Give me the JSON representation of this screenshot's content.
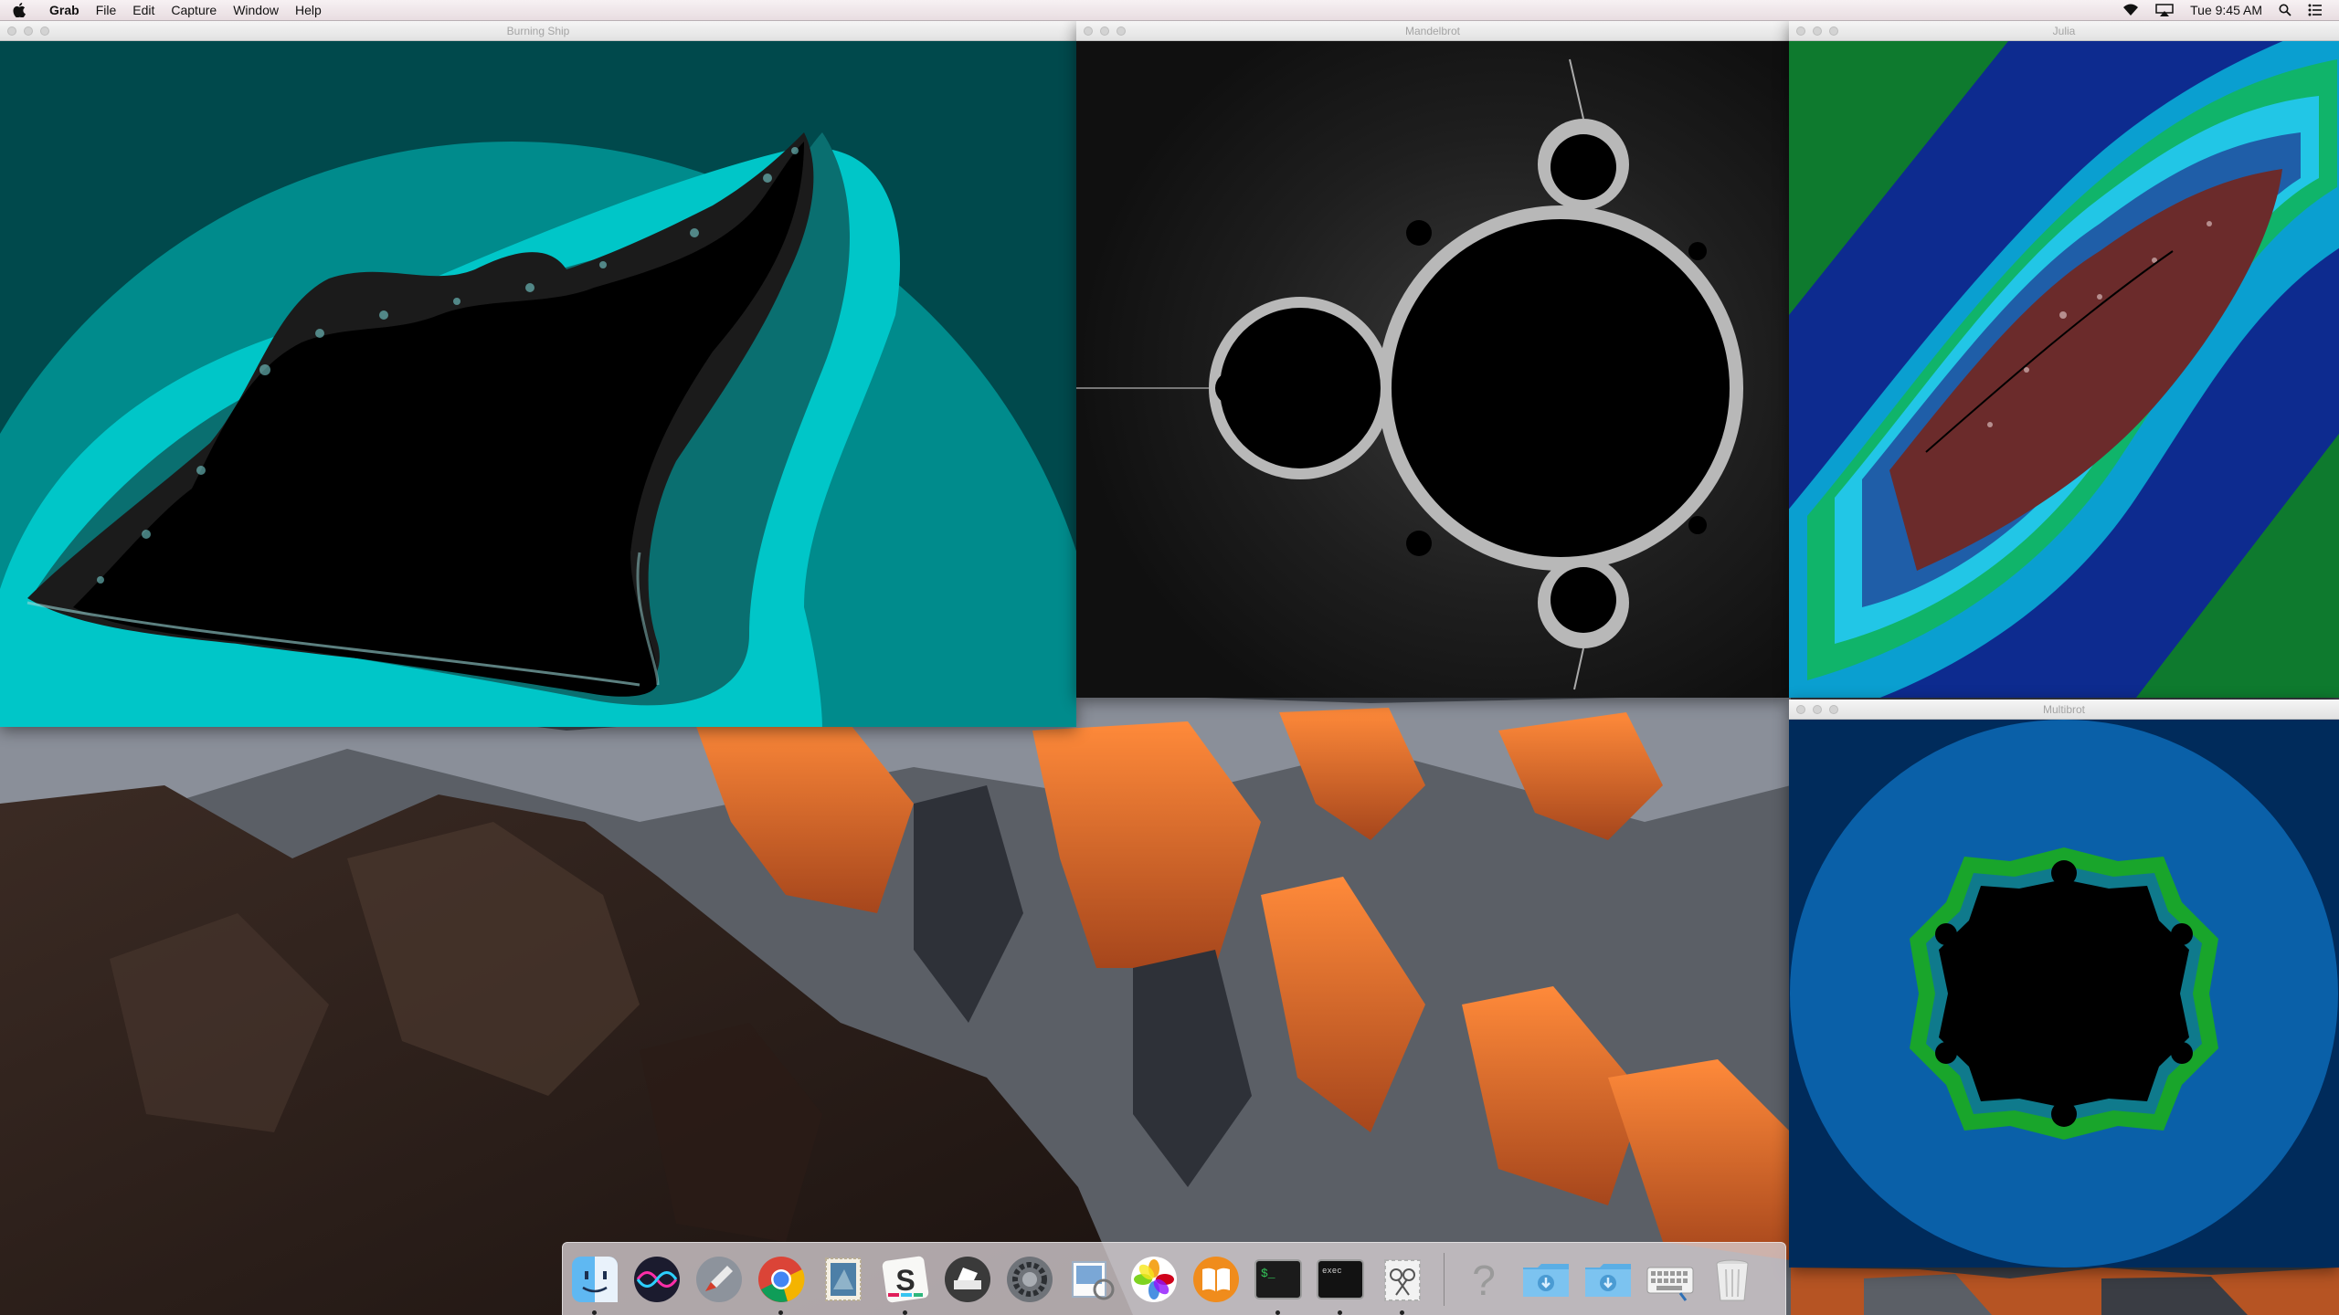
{
  "menubar": {
    "app_name": "Grab",
    "menus": [
      "File",
      "Edit",
      "Capture",
      "Window",
      "Help"
    ],
    "clock": "Tue 9:45 AM",
    "status_icons": [
      "wifi-icon",
      "airplay-icon",
      "spotlight-icon",
      "notification-center-icon"
    ]
  },
  "windows": {
    "burning_ship": {
      "title": "Burning Ship"
    },
    "mandelbrot": {
      "title": "Mandelbrot"
    },
    "julia": {
      "title": "Julia"
    },
    "multibrot": {
      "title": "Multibrot"
    }
  },
  "dock": {
    "apps": [
      {
        "name": "finder-icon",
        "running": true
      },
      {
        "name": "siri-icon",
        "running": false
      },
      {
        "name": "launchpad-icon",
        "running": false
      },
      {
        "name": "chrome-icon",
        "running": true
      },
      {
        "name": "mail-stamp-icon",
        "running": false
      },
      {
        "name": "slack-icon",
        "running": true
      },
      {
        "name": "scanner-icon",
        "running": false
      },
      {
        "name": "system-preferences-icon",
        "running": false
      },
      {
        "name": "preview-icon",
        "running": false
      },
      {
        "name": "photos-icon",
        "running": false
      },
      {
        "name": "ibooks-icon",
        "running": false
      },
      {
        "name": "terminal-icon",
        "running": true
      },
      {
        "name": "exec-terminal-icon",
        "running": true
      },
      {
        "name": "grab-icon",
        "running": true
      }
    ],
    "others": [
      "help-icon",
      "downloads-folder-icon",
      "downloads-stack-icon",
      "keyboard-viewer-icon",
      "trash-icon"
    ]
  },
  "colors": {
    "burning_ship_bg": "#00494c",
    "burning_ship_mid": "#008b8c",
    "burning_ship_light": "#00c6c8",
    "mandelbrot_bg": "#121212",
    "julia_blue": "#0d2b8f",
    "julia_green": "#0fbe6a",
    "multibrot_bg": "#002b5b",
    "multibrot_disc": "#0a60a8",
    "multibrot_ring": "#19a52b"
  }
}
